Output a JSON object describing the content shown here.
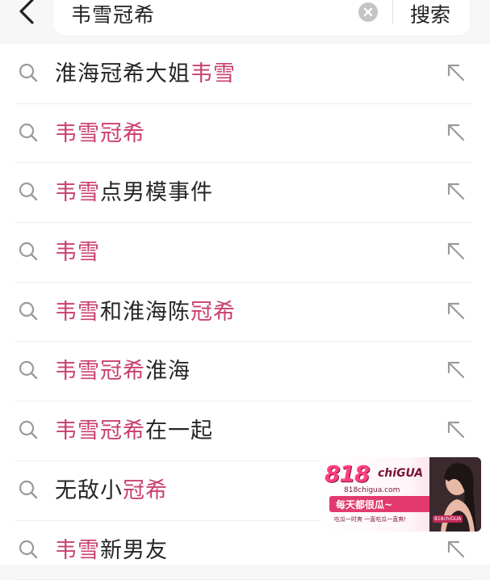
{
  "search": {
    "query": "韦雪冠希",
    "button_label": "搜索"
  },
  "suggestions": [
    {
      "parts": [
        {
          "t": "淮海冠希大姐",
          "hl": false
        },
        {
          "t": "韦雪",
          "hl": true
        }
      ]
    },
    {
      "parts": [
        {
          "t": "韦雪冠希",
          "hl": true
        }
      ]
    },
    {
      "parts": [
        {
          "t": "韦雪",
          "hl": true
        },
        {
          "t": "点男模事件",
          "hl": false
        }
      ]
    },
    {
      "parts": [
        {
          "t": "韦雪",
          "hl": true
        }
      ]
    },
    {
      "parts": [
        {
          "t": "韦雪",
          "hl": true
        },
        {
          "t": "和淮海陈",
          "hl": false
        },
        {
          "t": "冠希",
          "hl": true
        }
      ]
    },
    {
      "parts": [
        {
          "t": "韦雪冠希",
          "hl": true
        },
        {
          "t": "淮海",
          "hl": false
        }
      ]
    },
    {
      "parts": [
        {
          "t": "韦雪冠希",
          "hl": true
        },
        {
          "t": "在一起",
          "hl": false
        }
      ]
    },
    {
      "parts": [
        {
          "t": "无敌小",
          "hl": false
        },
        {
          "t": "冠希",
          "hl": true
        }
      ]
    },
    {
      "parts": [
        {
          "t": "韦雪",
          "hl": true
        },
        {
          "t": "新男友",
          "hl": false
        }
      ]
    }
  ],
  "ad": {
    "logo": "818",
    "brand": "chiGUA",
    "url": "818chigua.com",
    "slogan": "每天都很瓜~",
    "tagline": "吃瓜一时爽 一直吃瓜一直爽!",
    "badge": "818chiGUA"
  },
  "colors": {
    "highlight": "#c9416c",
    "text": "#262626",
    "icon": "#9a9a9a"
  },
  "icons": {
    "back": "chevron-left-icon",
    "clear": "clear-circle-icon",
    "row": "search-icon",
    "fill": "arrow-up-left-icon"
  }
}
